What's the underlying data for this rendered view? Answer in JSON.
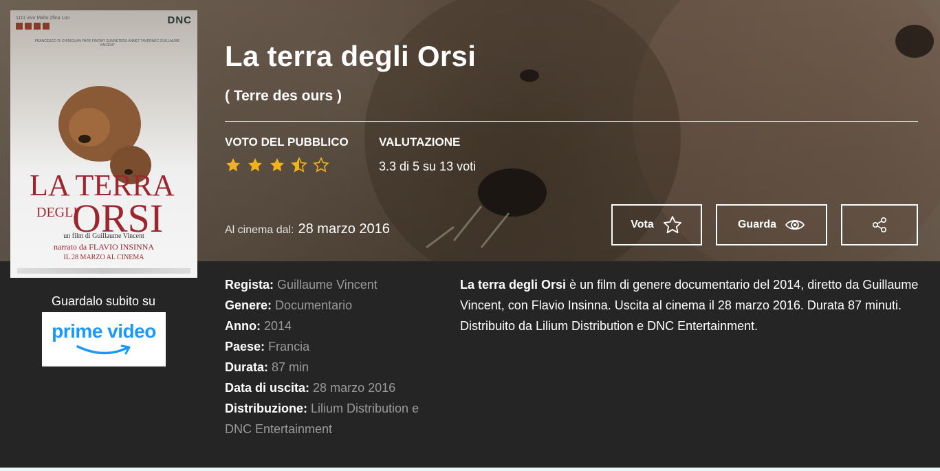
{
  "movie": {
    "title": "La terra degli Orsi",
    "original_title": "( Terre des ours )"
  },
  "ratings": {
    "audience_label": "VOTO DEL PUBBLICO",
    "stars_value": 3.5,
    "stars_max": 5,
    "rating_label": "VALUTAZIONE",
    "rating_text": "3.3 di 5 su 13 voti",
    "star_color": "#f2b21d"
  },
  "release": {
    "label": "Al cinema dal:",
    "value": "28 marzo 2016"
  },
  "actions": {
    "vote_label": "Vota",
    "vote_icon": "star-outline-icon",
    "watch_label": "Guarda",
    "watch_icon": "eye-icon",
    "share_icon": "share-icon"
  },
  "poster": {
    "top_text": "1111 vivo Malto 2fina Lon",
    "brand": "DNC",
    "credits": "FRANCESCO DI CHINIGUAN PAPE FINOMY SUNNETERS ANNET TAVERNEC GUILLAUME VINCENT",
    "title_line1": "LA TERRA",
    "title_line2": "ORSI",
    "title_small": "DEGLI",
    "subtitle": "un film di Guillaume Vincent",
    "narrator": "narrato da FLAVIO INSINNA",
    "date": "IL 28 MARZO AL CINEMA"
  },
  "streaming": {
    "label": "Guardalo subito su",
    "provider": "prime video"
  },
  "details": [
    {
      "key": "Regista:",
      "value": "Guillaume Vincent"
    },
    {
      "key": "Genere:",
      "value": "Documentario"
    },
    {
      "key": "Anno:",
      "value": "2014"
    },
    {
      "key": "Paese:",
      "value": "Francia"
    },
    {
      "key": "Durata:",
      "value": "87 min"
    },
    {
      "key": "Data di uscita:",
      "value": "28 marzo 2016"
    },
    {
      "key": "Distribuzione:",
      "value": "Lilium Distribution e DNC Entertainment"
    }
  ],
  "synopsis": {
    "bold": "La terra degli Orsi",
    "text": " è un film di genere documentario del 2014, diretto da Guillaume Vincent, con Flavio Insinna. Uscita al cinema il 28 marzo 2016. Durata 87 minuti. Distribuito da Lilium Distribution e DNC Entertainment."
  }
}
